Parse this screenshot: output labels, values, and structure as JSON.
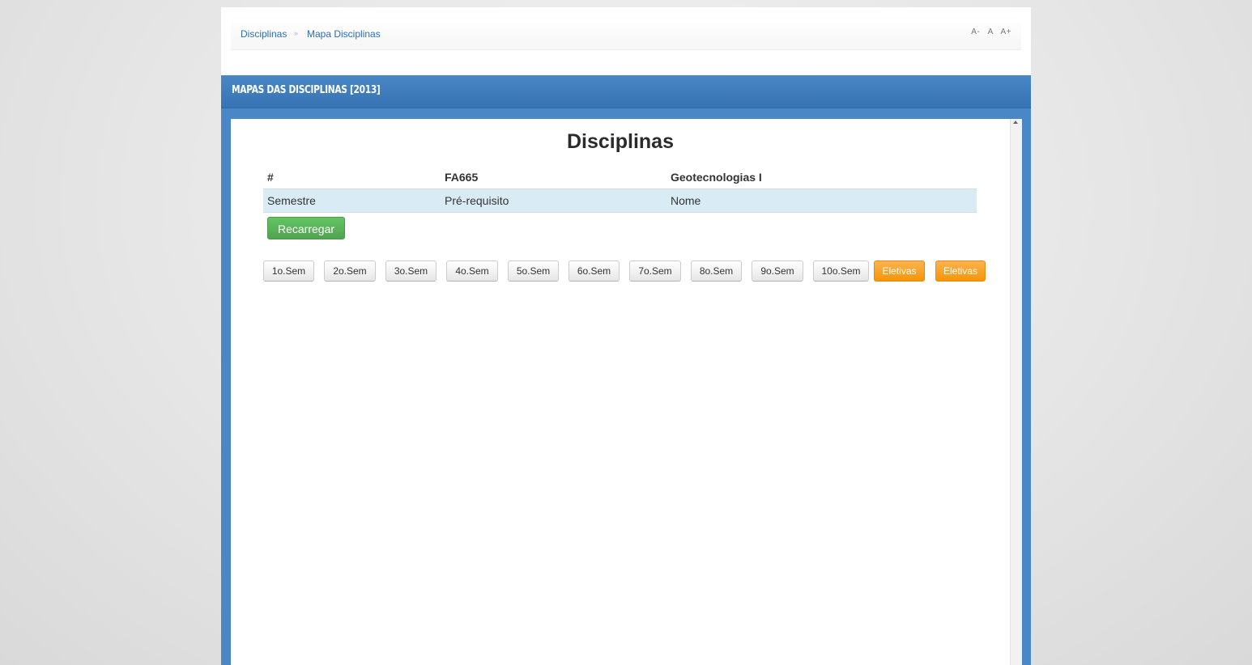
{
  "breadcrumb": {
    "items": [
      "Disciplinas",
      "Mapa Disciplinas"
    ],
    "separator": "»"
  },
  "font_tools": {
    "decrease": "A-",
    "normal": "A",
    "increase": "A+"
  },
  "panel": {
    "title": "Mapas das Disciplinas [2013]"
  },
  "main": {
    "heading": "Disciplinas",
    "table": {
      "headers": [
        "#",
        "FA665",
        "Geotecnologias I"
      ],
      "row": [
        "Semestre",
        "Pré-requisito",
        "Nome"
      ]
    },
    "reload_label": "Recarregar",
    "semester_buttons": [
      "1o.Sem",
      "2o.Sem",
      "3o.Sem",
      "4o.Sem",
      "5o.Sem",
      "6o.Sem",
      "7o.Sem",
      "8o.Sem",
      "9o.Sem",
      "10o.Sem"
    ],
    "elective_buttons": [
      "Eletivas",
      "Eletivas"
    ]
  },
  "colors": {
    "header_blue": "#3f7dbd",
    "success_green": "#5bb75b",
    "warning_orange": "#f89406"
  }
}
